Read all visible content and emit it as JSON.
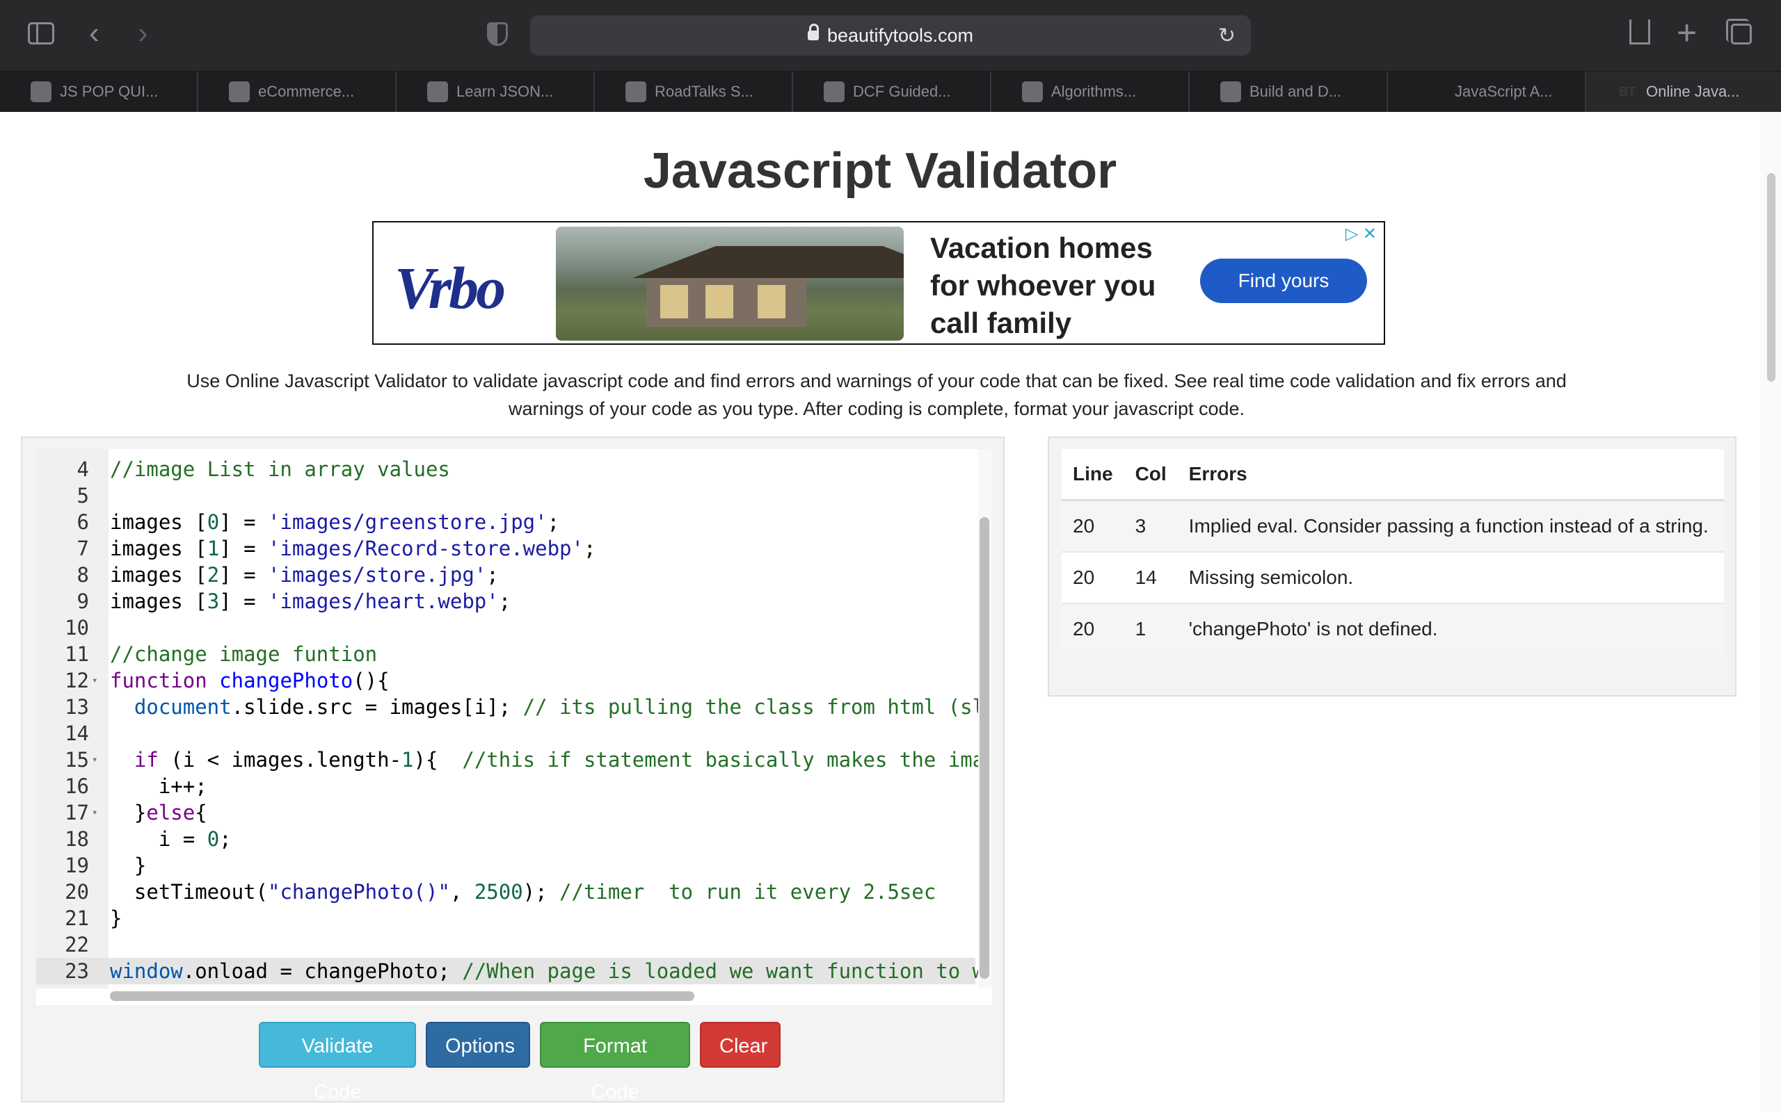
{
  "browser": {
    "url": "beautifytools.com",
    "tabs": [
      {
        "label": "JS POP QUI...",
        "icon": "snowflake-icon",
        "active": false
      },
      {
        "label": "eCommerce...",
        "icon": "document-icon",
        "active": false
      },
      {
        "label": "Learn JSON...",
        "icon": "video-icon",
        "active": false
      },
      {
        "label": "RoadTalks S...",
        "icon": "crosshair-icon",
        "active": false
      },
      {
        "label": "DCF Guided...",
        "icon": "document-icon",
        "active": false
      },
      {
        "label": "Algorithms...",
        "icon": "code-icon",
        "active": false
      },
      {
        "label": "Build and D...",
        "icon": "video-icon",
        "active": false
      },
      {
        "label": "JavaScript A...",
        "icon": "",
        "active": false
      },
      {
        "label": "Online Java...",
        "icon": "beautifytools-icon",
        "favicon_text": "BT",
        "active": true
      }
    ]
  },
  "page": {
    "title": "Javascript Validator",
    "description": "Use Online Javascript Validator to validate javascript code and find errors and warnings of your code that can be fixed. See real time code validation and fix errors and warnings of your code as you type. After coding is complete, format your javascript code."
  },
  "ad": {
    "logo": "Vrbo",
    "headline": "Vacation homes for whoever you call family",
    "cta": "Find yours",
    "adchoices": "▷ ✕"
  },
  "editor": {
    "lines": [
      {
        "n": "4",
        "fold": "",
        "active": false,
        "tokens": [
          {
            "t": "cm",
            "v": "//image List in array values"
          }
        ]
      },
      {
        "n": "5",
        "fold": "",
        "active": false,
        "tokens": []
      },
      {
        "n": "6",
        "fold": "",
        "active": false,
        "tokens": [
          {
            "t": "",
            "v": "images ["
          },
          {
            "t": "num",
            "v": "0"
          },
          {
            "t": "",
            "v": "] = "
          },
          {
            "t": "str",
            "v": "'images/greenstore.jpg'"
          },
          {
            "t": "",
            "v": ";"
          }
        ]
      },
      {
        "n": "7",
        "fold": "",
        "active": false,
        "tokens": [
          {
            "t": "",
            "v": "images ["
          },
          {
            "t": "num",
            "v": "1"
          },
          {
            "t": "",
            "v": "] = "
          },
          {
            "t": "str",
            "v": "'images/Record-store.webp'"
          },
          {
            "t": "",
            "v": ";"
          }
        ]
      },
      {
        "n": "8",
        "fold": "",
        "active": false,
        "tokens": [
          {
            "t": "",
            "v": "images ["
          },
          {
            "t": "num",
            "v": "2"
          },
          {
            "t": "",
            "v": "] = "
          },
          {
            "t": "str",
            "v": "'images/store.jpg'"
          },
          {
            "t": "",
            "v": ";"
          }
        ]
      },
      {
        "n": "9",
        "fold": "",
        "active": false,
        "tokens": [
          {
            "t": "",
            "v": "images ["
          },
          {
            "t": "num",
            "v": "3"
          },
          {
            "t": "",
            "v": "] = "
          },
          {
            "t": "str",
            "v": "'images/heart.webp'"
          },
          {
            "t": "",
            "v": ";"
          }
        ]
      },
      {
        "n": "10",
        "fold": "",
        "active": false,
        "tokens": []
      },
      {
        "n": "11",
        "fold": "",
        "active": false,
        "tokens": [
          {
            "t": "cm",
            "v": "//change image funtion"
          }
        ]
      },
      {
        "n": "12",
        "fold": "▾",
        "active": false,
        "tokens": [
          {
            "t": "kw",
            "v": "function"
          },
          {
            "t": "",
            "v": " "
          },
          {
            "t": "def",
            "v": "changePhoto"
          },
          {
            "t": "",
            "v": "(){"
          }
        ]
      },
      {
        "n": "13",
        "fold": "",
        "active": false,
        "tokens": [
          {
            "t": "",
            "v": "  "
          },
          {
            "t": "vr",
            "v": "document"
          },
          {
            "t": "",
            "v": ".slide.src = images[i]; "
          },
          {
            "t": "cm",
            "v": "// its pulling the class from html (slic"
          }
        ]
      },
      {
        "n": "14",
        "fold": "",
        "active": false,
        "tokens": []
      },
      {
        "n": "15",
        "fold": "▾",
        "active": false,
        "tokens": [
          {
            "t": "",
            "v": "  "
          },
          {
            "t": "kw",
            "v": "if"
          },
          {
            "t": "",
            "v": " (i < images.length-"
          },
          {
            "t": "num",
            "v": "1"
          },
          {
            "t": "",
            "v": "){  "
          },
          {
            "t": "cm",
            "v": "//this if statement basically makes the image"
          }
        ]
      },
      {
        "n": "16",
        "fold": "",
        "active": false,
        "tokens": [
          {
            "t": "",
            "v": "    i++;"
          }
        ]
      },
      {
        "n": "17",
        "fold": "▾",
        "active": false,
        "tokens": [
          {
            "t": "",
            "v": "  }"
          },
          {
            "t": "kw",
            "v": "else"
          },
          {
            "t": "",
            "v": "{"
          }
        ]
      },
      {
        "n": "18",
        "fold": "",
        "active": false,
        "tokens": [
          {
            "t": "",
            "v": "    i = "
          },
          {
            "t": "num",
            "v": "0"
          },
          {
            "t": "",
            "v": ";"
          }
        ]
      },
      {
        "n": "19",
        "fold": "",
        "active": false,
        "tokens": [
          {
            "t": "",
            "v": "  }"
          }
        ]
      },
      {
        "n": "20",
        "fold": "",
        "active": false,
        "tokens": [
          {
            "t": "",
            "v": "  setTimeout("
          },
          {
            "t": "str",
            "v": "\"changePhoto()\""
          },
          {
            "t": "",
            "v": ", "
          },
          {
            "t": "num",
            "v": "2500"
          },
          {
            "t": "",
            "v": "); "
          },
          {
            "t": "cm",
            "v": "//timer  to run it every 2.5sec"
          }
        ]
      },
      {
        "n": "21",
        "fold": "",
        "active": false,
        "tokens": [
          {
            "t": "",
            "v": "}"
          }
        ]
      },
      {
        "n": "22",
        "fold": "",
        "active": false,
        "tokens": []
      },
      {
        "n": "23",
        "fold": "",
        "active": true,
        "tokens": [
          {
            "t": "vr",
            "v": "window"
          },
          {
            "t": "",
            "v": ".onload = changePhoto; "
          },
          {
            "t": "cm",
            "v": "//When page is loaded we want function to wor"
          }
        ]
      }
    ]
  },
  "buttons": {
    "validate": "Validate Code",
    "options": "Options",
    "format": "Format Code",
    "clear": "Clear"
  },
  "errors": {
    "headers": {
      "line": "Line",
      "col": "Col",
      "errors": "Errors"
    },
    "rows": [
      {
        "line": "20",
        "col": "3",
        "message": "Implied eval. Consider passing a function instead of a string."
      },
      {
        "line": "20",
        "col": "14",
        "message": "Missing semicolon."
      },
      {
        "line": "20",
        "col": "1",
        "message": "'changePhoto' is not defined."
      }
    ]
  }
}
